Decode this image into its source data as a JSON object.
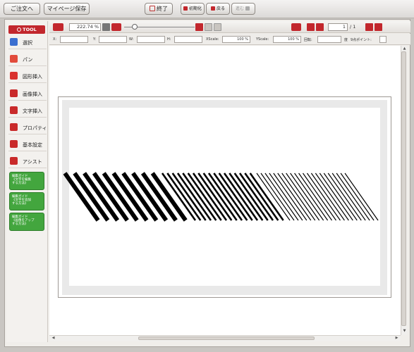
{
  "topbar": {
    "order_label": "ご注文へ",
    "save_label": "マイページ保存",
    "quit_label": "終了",
    "reset_label": "初期化",
    "back_label": "戻る",
    "forward_label": "進む"
  },
  "toolbar": {
    "zoom_value": "222.74",
    "zoom_unit": "%",
    "page_current": "1",
    "page_total": "/ 1"
  },
  "properties": {
    "x_label": "X:",
    "y_label": "Y:",
    "w_label": "W:",
    "h_label": "H:",
    "xscale_label": "XScale:",
    "xscale_value": "100 %",
    "yscale_label": "YScale:",
    "yscale_value": "100 %",
    "rotate_label": "回転:",
    "degree_label": "度",
    "point_label": "9点ポイント:"
  },
  "tools": {
    "header": "TOOL",
    "items": [
      {
        "label": "選択",
        "color": "#3b6fd0"
      },
      {
        "label": "パン",
        "color": "#e24b3b"
      },
      {
        "label": "図形挿入",
        "color": "#d9322e"
      },
      {
        "label": "画像挿入",
        "color": "#c92a2a"
      },
      {
        "label": "文字挿入",
        "color": "#c92a2a"
      },
      {
        "label": "プロパティ",
        "color": "#c92a2a"
      },
      {
        "label": "基本設定",
        "color": "#c92a2a"
      },
      {
        "label": "アシスト",
        "color": "#c92a2a"
      }
    ],
    "guides": [
      "編集ガイド\n《文字を編集\nする方法》",
      "編集ガイド\n《文字を追加\nする方法》",
      "編集ガイド\n《画像をアップ\nする方法》"
    ]
  },
  "colors": {
    "accent": "#c2272d",
    "guide_green": "#43a63e"
  }
}
